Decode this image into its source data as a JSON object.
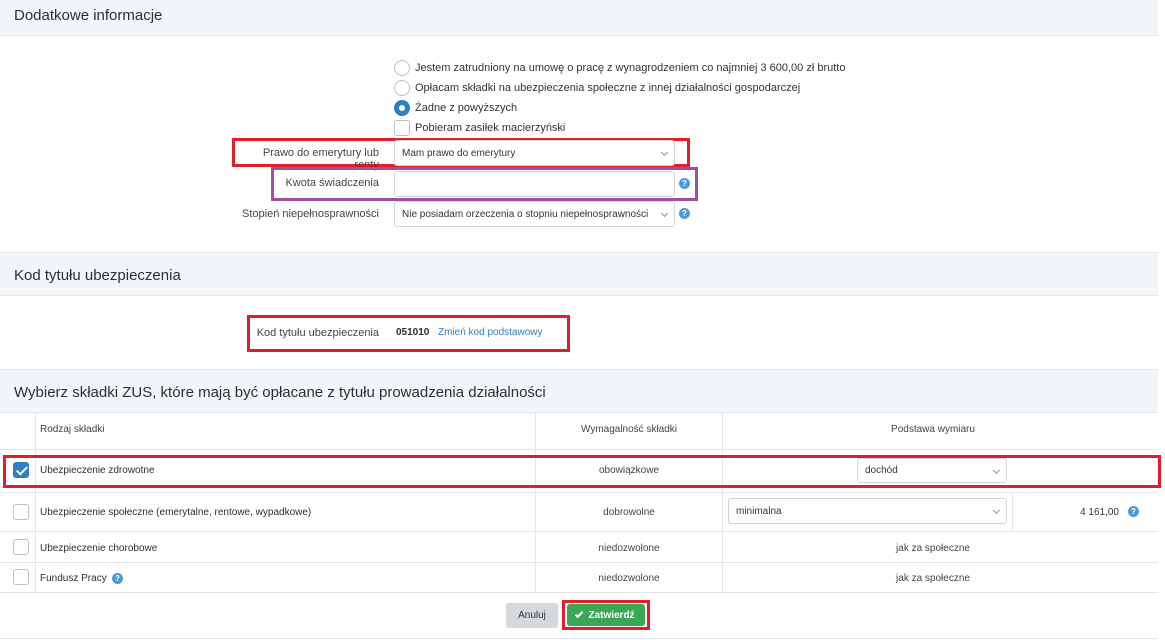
{
  "sections": {
    "additional_info_title": "Dodatkowe informacje",
    "insurance_code_title": "Kod tytułu ubezpieczenia",
    "zus_title": "Wybierz składki ZUS, które mają być opłacane z tytułu prowadzenia działalności"
  },
  "options": {
    "employed": "Jestem zatrudniony na umowę o pracę z wynagrodzeniem co najmniej 3 600,00 zł brutto",
    "other_business": "Opłacam składki na ubezpieczenia społeczne z innej działalności gospodarczej",
    "none": "Żadne z powyższych",
    "maternity": "Pobieram zasiłek macierzyński"
  },
  "fields": {
    "pension_label": "Prawo do emerytury lub renty",
    "pension_value": "Mam prawo do emerytury",
    "benefit_label": "Kwota świadczenia",
    "benefit_value": "",
    "disability_label": "Stopień niepełnosprawności",
    "disability_value": "Nie posiadam orzeczenia o stopniu niepełnosprawności"
  },
  "insurance_code": {
    "label": "Kod tytułu ubezpieczenia",
    "value": "051010",
    "change_link": "Zmień kod podstawowy"
  },
  "table": {
    "headers": {
      "type": "Rodzaj składki",
      "due": "Wymagalność składki",
      "base": "Podstawa wymiaru"
    },
    "rows": [
      {
        "name": "Ubezpieczenie zdrowotne",
        "due": "obowiązkowe",
        "base": "dochód",
        "amount": ""
      },
      {
        "name": "Ubezpieczenie społeczne (emerytalne, rentowe, wypadkowe)",
        "due": "dobrowolne",
        "base": "minimalna",
        "amount": "4 161,00"
      },
      {
        "name": "Ubezpieczenie chorobowe",
        "due": "niedozwolone",
        "base": "jak za społeczne",
        "amount": ""
      },
      {
        "name": "Fundusz Pracy",
        "due": "niedozwolone",
        "base": "jak za społeczne",
        "amount": ""
      }
    ]
  },
  "buttons": {
    "cancel": "Anuluj",
    "confirm": "Zatwierdź"
  },
  "icons": {
    "help": "?"
  },
  "colors": {
    "accent": "#2f7fc1",
    "confirm": "#3aa757",
    "highlight_red": "#e21e2a",
    "highlight_purple": "#9b52a5"
  }
}
